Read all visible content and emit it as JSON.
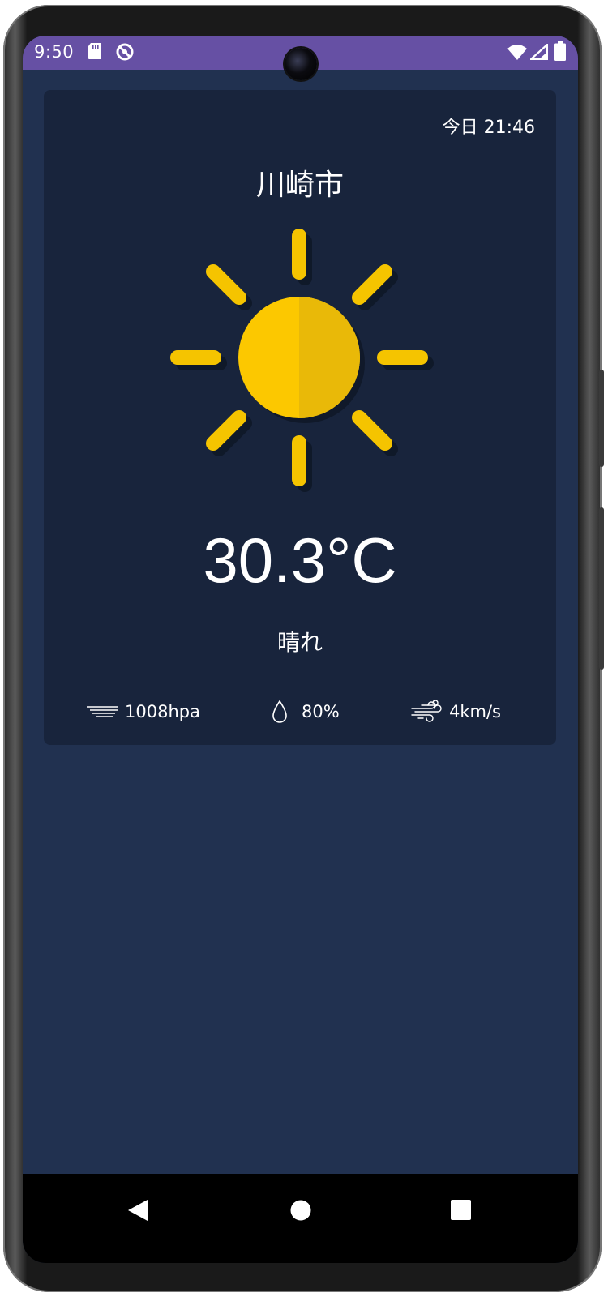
{
  "status_bar": {
    "time": "9:50",
    "color": "#6650a4",
    "left_icons": [
      "sd-card-icon",
      "sync-icon"
    ],
    "right_icons": [
      "wifi-icon",
      "cell-signal-icon",
      "battery-icon"
    ]
  },
  "weather": {
    "date_time": "今日 21:46",
    "city": "川崎市",
    "condition_icon": "sun-icon",
    "temperature": "30.3°C",
    "condition": "晴れ",
    "stats": [
      {
        "icon": "pressure-icon",
        "value": "1008hpa"
      },
      {
        "icon": "humidity-drop-icon",
        "value": "80%"
      },
      {
        "icon": "wind-icon",
        "value": "4km/s"
      }
    ]
  },
  "nav_bar": {
    "buttons": [
      "back-icon",
      "home-icon",
      "recents-icon"
    ]
  },
  "colors": {
    "background": "#213150",
    "card": "#18243c",
    "sun": "#fcc800",
    "sun_shade": "#e9b908"
  }
}
